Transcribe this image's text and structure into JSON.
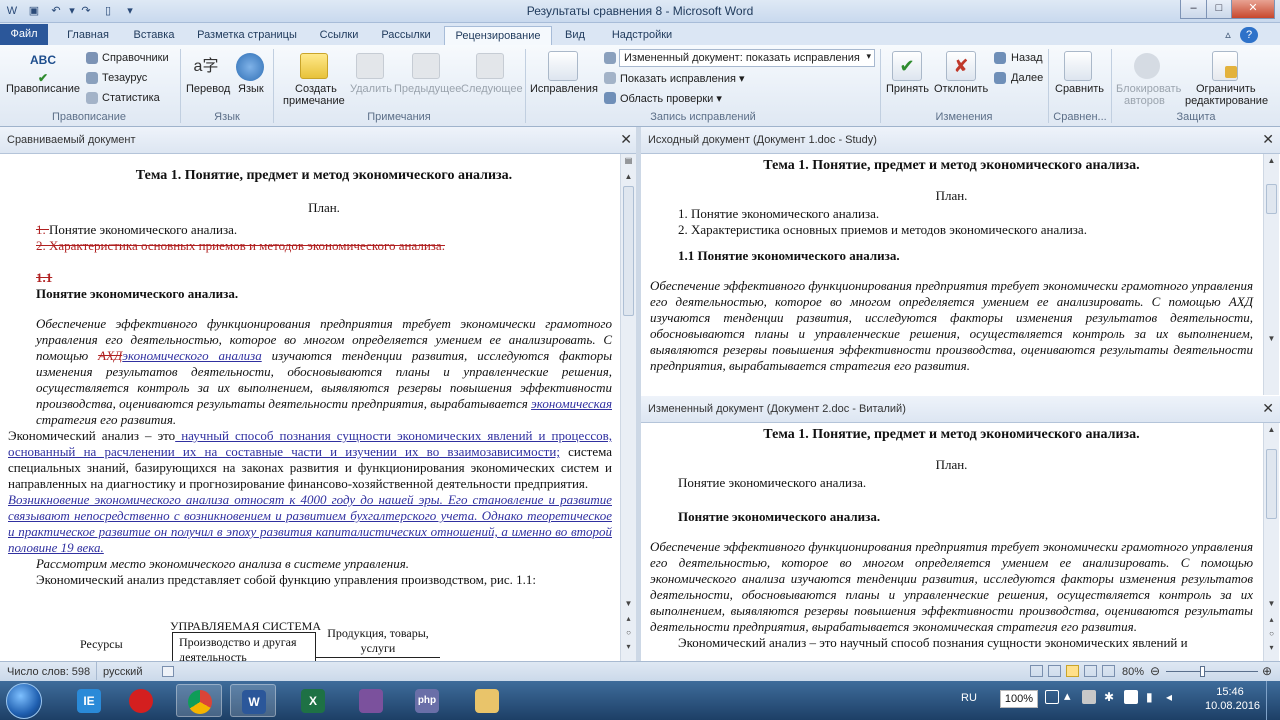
{
  "window": {
    "title": "Результаты сравнения 8 - Microsoft Word",
    "minimize": "–",
    "maximize": "□",
    "close": "✕"
  },
  "tabs": [
    "Файл",
    "Главная",
    "Вставка",
    "Разметка страницы",
    "Ссылки",
    "Рассылки",
    "Рецензирование",
    "Вид",
    "Надстройки"
  ],
  "active_tab": "Рецензирование",
  "ribbon": {
    "spelling": "Правописание",
    "references": "Справочники",
    "thesaurus": "Тезаурус",
    "statistics": "Статистика",
    "group_spelling": "Правописание",
    "translate": "Перевод",
    "language": "Язык",
    "group_language": "Язык",
    "new_comment_1": "Создать",
    "new_comment_2": "примечание",
    "delete": "Удалить",
    "previous": "Предыдущее",
    "next": "Следующее",
    "group_comments": "Примечания",
    "corrections": "Исправления",
    "display_select": "Измененный документ: показать исправления",
    "show_markup": "Показать исправления",
    "review_pane": "Область проверки",
    "group_tracking": "Запись исправлений",
    "accept": "Принять",
    "reject": "Отклонить",
    "back": "Назад",
    "forward": "Далее",
    "group_changes": "Изменения",
    "compare": "Сравнить",
    "group_compare": "Сравнен...",
    "block_authors_1": "Блокировать",
    "block_authors_2": "авторов",
    "restrict_1": "Ограничить",
    "restrict_2": "редактирование",
    "group_protect": "Защита"
  },
  "left_pane": {
    "header": "Сравниваемый документ",
    "title": "Тема 1. Понятие, предмет и метод экономического анализа.",
    "plan": "План.",
    "item1_del": "1. ",
    "item1": "Понятие экономического анализа.",
    "item2_del": "2. Характеристика основных приемов и методов экономического анализа.",
    "sec_del": "1.1",
    "sec_title": "Понятие экономического анализа.",
    "p1_a": "Обеспечение эффективного функционирования предприятия требует экономически грамотного управления его деятельностью, которое во многом определяется умением ее анализировать. С помощью ",
    "p1_del": "АХД",
    "p1_ins": "экономического анализа",
    "p1_b": " изучаются тенденции развития, исследуются факторы изменения результатов деятельности, обосновываются планы и управленческие решения, осуществляется контроль за их выполнением, выявляются резервы повышения эффективности производства, оцениваются результаты деятельности предприятия, вырабатывается ",
    "p1_ins2": "экономическая",
    "p1_c": " стратегия его развития.",
    "p2_a": "Экономический анализ – это",
    "p2_ins": " научный способ познания сущности экономических явлений и процессов, основанный на расчленении их на составные части и изучении их во взаимозависимости;",
    "p2_b": " система специальных знаний, базирующихся на законах развития и функционирования экономических систем и направленных на диагностику и прогнозирование финансово-хозяйственной деятельности предприятия.",
    "p3_ins": "Возникновение экономического анализа относят к 4000 году до нашей эры. Его становление и развитие связывают непосредственно с возникновением и развитием бухгалтерского учета. Однако теоретическое и практическое развитие он получил в эпоху развития капиталистических отношений, а именно во второй половине 19 века.",
    "p4": "Рассмотрим место экономического анализа в системе управления.",
    "p5": "Экономический анализ представляет собой функцию управления производством, рис. 1.1:",
    "fig_system": "УПРАВЛЯЕМАЯ СИСТЕМА",
    "fig_resources": "Ресурсы",
    "fig_box": "Производство и другая деятельность",
    "fig_output": "Продукция, товары, услуги"
  },
  "right_top": {
    "header": "Исходный документ (Документ 1.doc - Study)",
    "title": "Тема 1. Понятие, предмет и метод экономического анализа.",
    "plan": "План.",
    "item1": "1. Понятие экономического анализа.",
    "item2": "2. Характеристика основных приемов и методов экономического анализа.",
    "sec_title": "1.1  Понятие экономического анализа.",
    "p1": "Обеспечение эффективного функционирования предприятия требует экономически грамотного управления его деятельностью, которое во многом определяется умением ее анализировать. С помощью АХД изучаются тенденции развития, исследуются факторы изменения результатов деятельности, обосновываются планы и управленческие решения, осуществляется контроль за их выполнением, выявляются резервы повышения эффективности производства, оцениваются результаты деятельности предприятия, вырабатывается стратегия его развития."
  },
  "right_bottom": {
    "header": "Измененный документ (Документ 2.doc - Виталий)",
    "title": "Тема 1. Понятие, предмет и метод экономического анализа.",
    "plan": "План.",
    "item1": "Понятие экономического анализа.",
    "sec_title": "Понятие экономического анализа.",
    "p1": "Обеспечение эффективного функционирования предприятия требует экономически грамотного управления его деятельностью, которое во многом определяется умением ее анализировать. С помощью экономического анализа изучаются тенденции развития, исследуются факторы изменения результатов деятельности, обосновываются планы и управленческие решения, осуществляется контроль за их выполнением, выявляются резервы повышения эффективности производства, оцениваются результаты деятельности предприятия, вырабатывается экономическая стратегия его развития.",
    "p2": "Экономический анализ – это научный способ познания сущности экономических явлений и"
  },
  "status": {
    "words": "Число слов: 598",
    "language": "русский",
    "zoom": "80%"
  },
  "taskbar": {
    "lang": "RU",
    "battery": "100%",
    "time": "15:46",
    "date": "10.08.2016",
    "apps": [
      "IE",
      "Opera",
      "Chrome",
      "Word",
      "Excel",
      "Viber",
      "PHP",
      "Explorer"
    ]
  },
  "colors": {
    "accent": "#2b579a",
    "deletion": "#b02020",
    "insertion": "#3030a0"
  }
}
